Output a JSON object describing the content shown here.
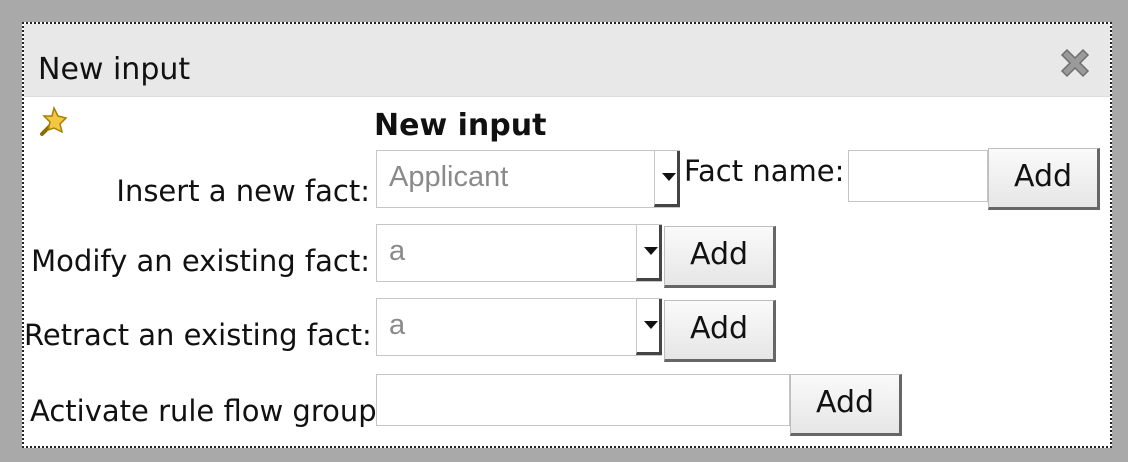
{
  "dialog": {
    "title": "New input",
    "close_icon": "close-x-icon",
    "wand_icon": "magic-wand-icon",
    "heading": "New input"
  },
  "rows": {
    "insert": {
      "label": "Insert a new fact:",
      "selected": "Applicant",
      "fact_name_label": "Fact name:",
      "fact_name_value": "",
      "add_label": "Add"
    },
    "modify": {
      "label": "Modify an existing fact:",
      "selected": "a",
      "add_label": "Add"
    },
    "retract": {
      "label": "Retract an existing fact:",
      "selected": "a",
      "add_label": "Add"
    },
    "activate": {
      "label": "Activate rule flow group",
      "value": "",
      "add_label": "Add"
    }
  }
}
